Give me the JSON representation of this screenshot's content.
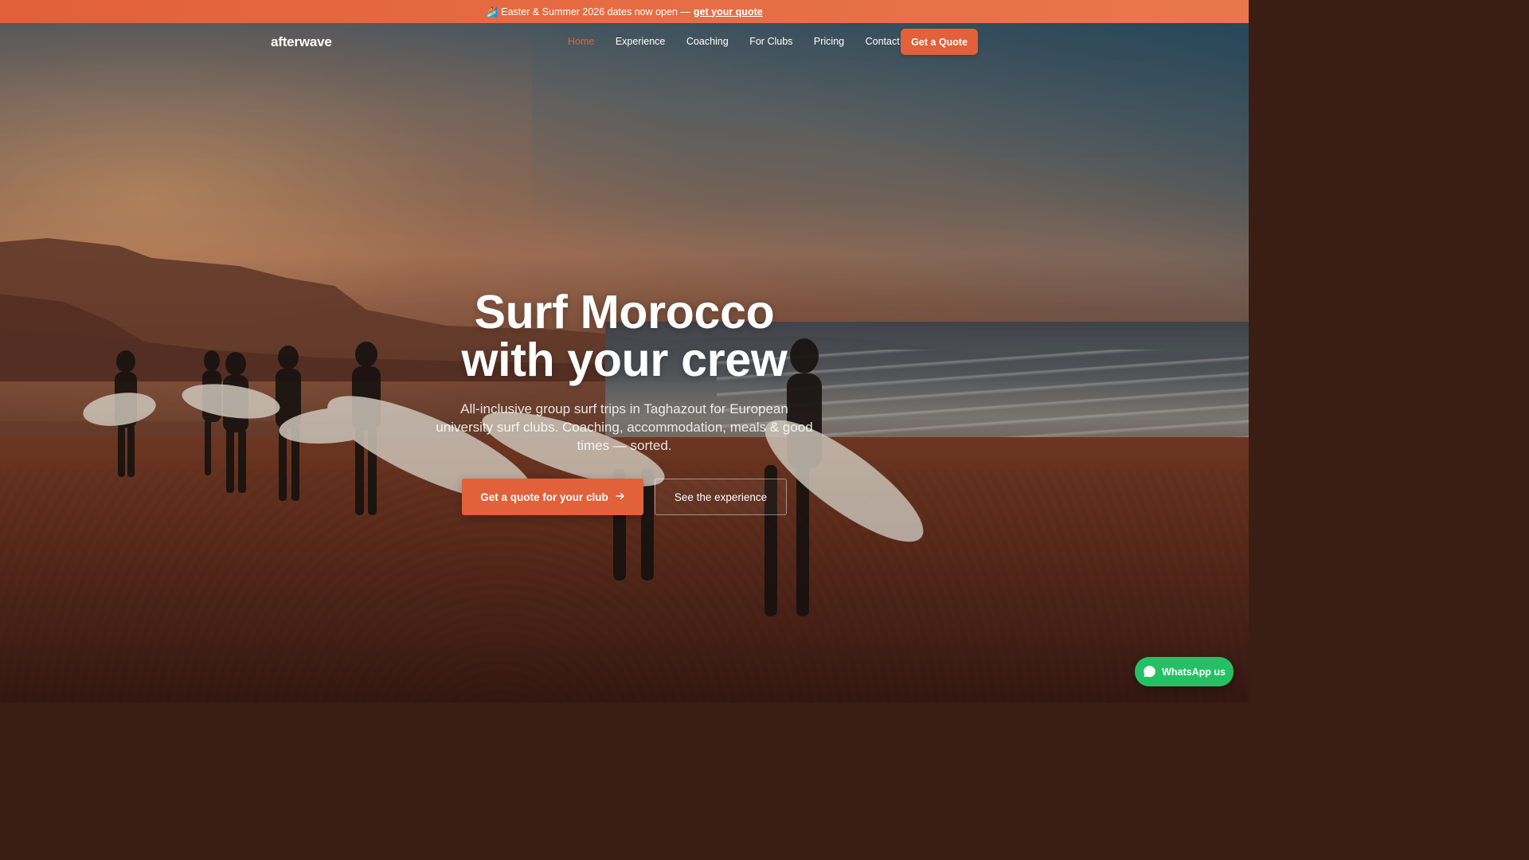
{
  "announcement": {
    "emoji": "🏄",
    "text": "Easter & Summer 2026 dates now open —",
    "link_label": "get your quote"
  },
  "nav": {
    "logo": "afterwave",
    "links": [
      "Home",
      "Experience",
      "Coaching",
      "For Clubs",
      "Pricing",
      "Contact"
    ],
    "active_link": "Home",
    "cta_label": "Get a Quote"
  },
  "hero": {
    "headline_line1": "Surf Morocco",
    "headline_line2": "with your crew",
    "subhead": "All-inclusive group surf trips in Taghazout for European university surf clubs. Coaching, accommodation, meals & good times — sorted.",
    "primary_cta": "Get a quote for your club",
    "primary_cta_icon": "arrow-right-icon",
    "secondary_cta": "See the experience"
  },
  "whatsapp": {
    "label": "WhatsApp us",
    "icon": "chat-bubble-icon"
  },
  "colors": {
    "accent": "#e2603a",
    "whatsapp_green": "#25c063"
  }
}
